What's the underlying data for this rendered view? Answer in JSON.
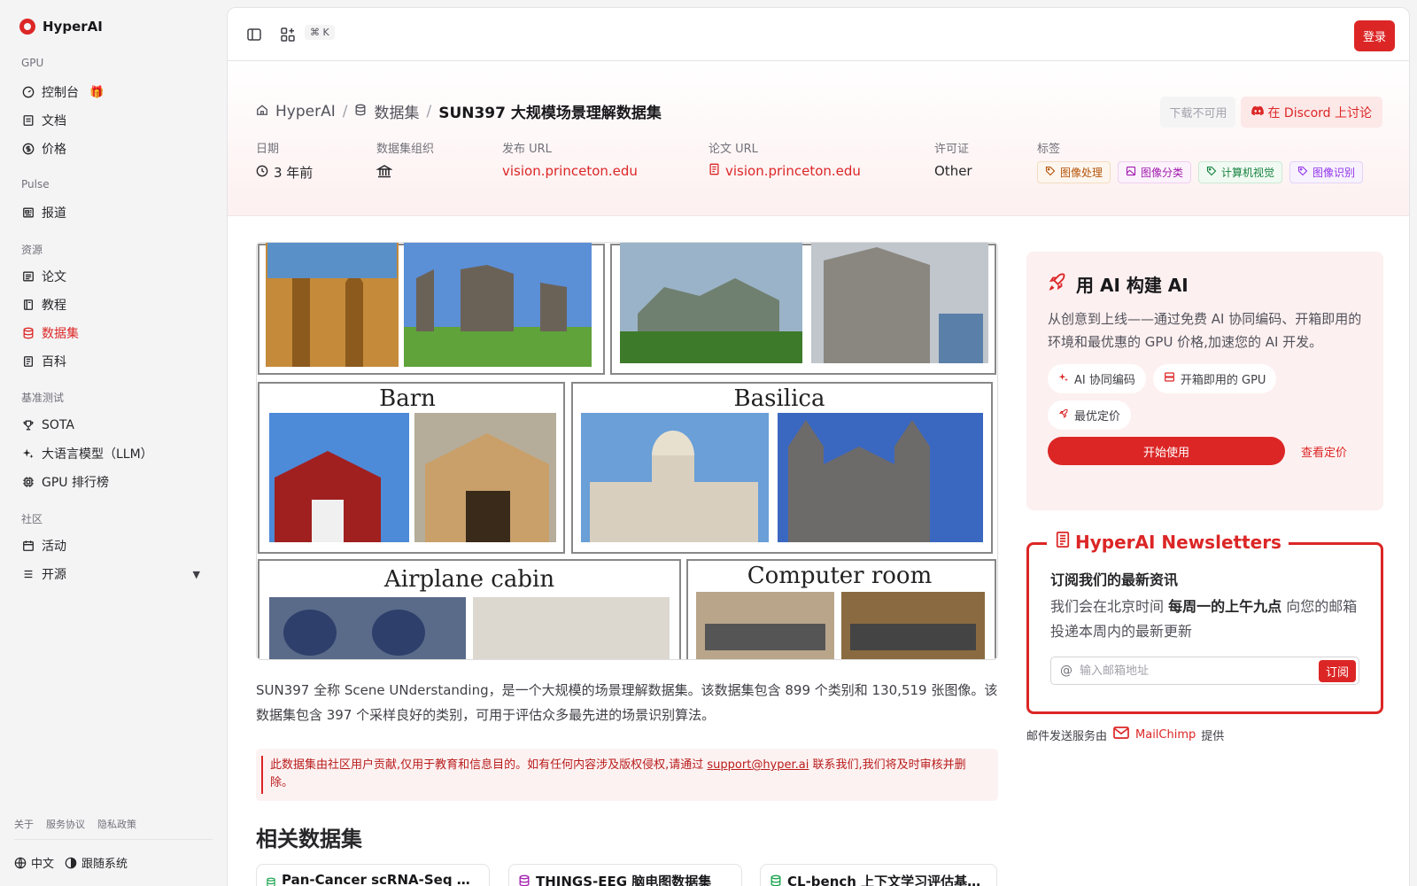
{
  "brand": {
    "name": "HyperAI",
    "accent": "#dc2626"
  },
  "sidebar": {
    "groups": [
      {
        "label": "GPU",
        "items": [
          {
            "label": "控制台",
            "icon": "gauge-icon"
          },
          {
            "label": "文档",
            "icon": "doc-icon"
          },
          {
            "label": "价格",
            "icon": "dollar-icon"
          }
        ]
      },
      {
        "label": "Pulse",
        "items": [
          {
            "label": "报道",
            "icon": "newspaper-icon"
          }
        ]
      },
      {
        "label": "资源",
        "items": [
          {
            "label": "论文",
            "icon": "paper-icon"
          },
          {
            "label": "教程",
            "icon": "book-icon"
          },
          {
            "label": "数据集",
            "icon": "database-icon",
            "active": true
          },
          {
            "label": "百科",
            "icon": "encyclopedia-icon"
          }
        ]
      },
      {
        "label": "基准测试",
        "items": [
          {
            "label": "SOTA",
            "icon": "trophy-icon"
          },
          {
            "label": "大语言模型（LLM）",
            "icon": "sparkle-icon"
          },
          {
            "label": "GPU 排行榜",
            "icon": "chip-icon"
          }
        ]
      },
      {
        "label": "社区",
        "items": [
          {
            "label": "活动",
            "icon": "calendar-icon"
          },
          {
            "label": "开源",
            "icon": "list-icon"
          }
        ]
      }
    ],
    "footer_links": [
      "关于",
      "服务协议",
      "隐私政策"
    ],
    "language": "中文",
    "theme": "跟随系统"
  },
  "topbar": {
    "shortcut": "⌘ K",
    "login": "登录"
  },
  "breadcrumb": {
    "home": "HyperAI",
    "section": "数据集",
    "current": "SUN397 大规模场景理解数据集"
  },
  "actions": {
    "download": "下载不可用",
    "discord": "在 Discord 上讨论"
  },
  "meta": {
    "date_label": "日期",
    "date": "3 年前",
    "org_label": "数据集组织",
    "release_label": "发布 URL",
    "release_url": "vision.princeton.edu",
    "paper_label": "论文 URL",
    "paper_url": "vision.princeton.edu",
    "license_label": "许可证",
    "license": "Other",
    "tags_label": "标签",
    "tags": [
      {
        "text": "图像处理",
        "color": "#b45309",
        "bg": "#fdf6ee"
      },
      {
        "text": "图像分类",
        "color": "#a21caf",
        "bg": "#fbf2fb"
      },
      {
        "text": "计算机视觉",
        "color": "#15803d",
        "bg": "#f0faf2"
      },
      {
        "text": "图像识别",
        "color": "#9333ea",
        "bg": "#f7f2fd"
      }
    ]
  },
  "image": {
    "labels": [
      "Barn",
      "Basilica",
      "Airplane cabin",
      "Computer room"
    ]
  },
  "description": "SUN397 全称 Scene UNderstanding，是一个大规模的场景理解数据集。该数据集包含 899 个类别和 130,519 张图像。该数据集包含 397 个采样良好的类别，可用于评估众多最先进的场景识别算法。",
  "notice": {
    "text_before": "此数据集由社区用户贡献,仅用于教育和信息目的。如有任何内容涉及版权侵权,请通过 ",
    "email": "support@hyper.ai",
    "text_after": " 联系我们,我们将及时审核并删除。"
  },
  "related": {
    "title": "相关数据集",
    "items": [
      "Pan-Cancer scRNA-Seq …",
      "THINGS-EEG 脑电图数据集",
      "CL-bench 上下文学习评估基…"
    ]
  },
  "promo": {
    "title": "用 AI 构建 AI",
    "desc": "从创意到上线——通过免费 AI 协同编码、开箱即用的环境和最优惠的 GPU 价格,加速您的 AI 开发。",
    "chips": [
      "AI 协同编码",
      "开箱即用的 GPU",
      "最优定价"
    ],
    "start": "开始使用",
    "pricing": "查看定价"
  },
  "newsletter": {
    "legend": "HyperAI Newsletters",
    "heading": "订阅我们的最新资讯",
    "p_before": "我们会在北京时间 ",
    "p_bold": "每周一的上午九点",
    "p_after": " 向您的邮箱投递本周内的最新更新",
    "placeholder": "输入邮箱地址",
    "subscribe": "订阅",
    "footer_before": "邮件发送服务由",
    "footer_brand": "MailChimp",
    "footer_after": "提供"
  }
}
